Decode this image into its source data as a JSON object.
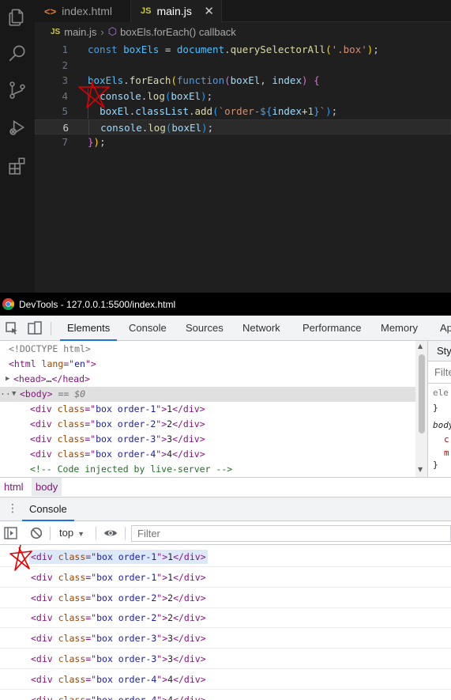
{
  "vscode": {
    "tabs": [
      {
        "label": "index.html",
        "icon": "<>"
      },
      {
        "label": "main.js",
        "icon": "JS",
        "close": "✕"
      }
    ],
    "breadcrumb": {
      "js_icon": "JS",
      "file": "main.js",
      "separator": "›",
      "symbol": "boxEls.forEach() callback"
    },
    "code_lines": [
      {
        "n": "1",
        "tokens": [
          [
            "t-kw",
            "const "
          ],
          [
            "t-var",
            "boxEls"
          ],
          [
            "t-op",
            " = "
          ],
          [
            "t-var",
            "document"
          ],
          [
            "t-pun",
            "."
          ],
          [
            "t-fn",
            "querySelectorAll"
          ],
          [
            "t-br1",
            "("
          ],
          [
            "t-str",
            "'.box'"
          ],
          [
            "t-br1",
            ")"
          ],
          [
            "t-pun",
            ";"
          ]
        ]
      },
      {
        "n": "2",
        "tokens": []
      },
      {
        "n": "3",
        "tokens": [
          [
            "t-var",
            "boxEls"
          ],
          [
            "t-pun",
            "."
          ],
          [
            "t-fn",
            "forEach"
          ],
          [
            "t-br1",
            "("
          ],
          [
            "t-kw",
            "function"
          ],
          [
            "t-br2",
            "("
          ],
          [
            "t-par",
            "boxEl"
          ],
          [
            "t-pun",
            ", "
          ],
          [
            "t-par",
            "index"
          ],
          [
            "t-br2",
            ")"
          ],
          [
            "t-pun",
            " "
          ],
          [
            "t-br2",
            "{"
          ]
        ]
      },
      {
        "n": "4",
        "tokens": [
          [
            "t-pun",
            "  "
          ],
          [
            "t-par",
            "console"
          ],
          [
            "t-pun",
            "."
          ],
          [
            "t-fn",
            "log"
          ],
          [
            "t-br3",
            "("
          ],
          [
            "t-par",
            "boxEl"
          ],
          [
            "t-br3",
            ")"
          ],
          [
            "t-pun",
            ";"
          ]
        ]
      },
      {
        "n": "5",
        "tokens": [
          [
            "t-pun",
            "  "
          ],
          [
            "t-par",
            "boxEl"
          ],
          [
            "t-pun",
            "."
          ],
          [
            "t-par",
            "classList"
          ],
          [
            "t-pun",
            "."
          ],
          [
            "t-fn",
            "add"
          ],
          [
            "t-br3",
            "("
          ],
          [
            "t-str",
            "`order-"
          ],
          [
            "t-tpl",
            "${"
          ],
          [
            "t-par",
            "index"
          ],
          [
            "t-op",
            "+"
          ],
          [
            "t-num",
            "1"
          ],
          [
            "t-tpl",
            "}"
          ],
          [
            "t-str",
            "`"
          ],
          [
            "t-br3",
            ")"
          ],
          [
            "t-pun",
            ";"
          ]
        ]
      },
      {
        "n": "6",
        "tokens": [
          [
            "t-pun",
            "  "
          ],
          [
            "t-par",
            "console"
          ],
          [
            "t-pun",
            "."
          ],
          [
            "t-fn",
            "log"
          ],
          [
            "t-br3",
            "("
          ],
          [
            "t-par",
            "boxEl"
          ],
          [
            "t-br3",
            ")"
          ],
          [
            "t-pun",
            ";"
          ]
        ]
      },
      {
        "n": "7",
        "tokens": [
          [
            "t-br2",
            "}"
          ],
          [
            "t-br1",
            ")"
          ],
          [
            "t-pun",
            ";"
          ]
        ]
      }
    ],
    "current_line": "6"
  },
  "devtools": {
    "title": "DevTools - 127.0.0.1:5500/index.html",
    "tabs": [
      "Elements",
      "Console",
      "Sources",
      "Network",
      "Performance",
      "Memory",
      "Ap"
    ],
    "active_tab": "Elements",
    "elements": [
      {
        "tri": "",
        "tokens": [
          [
            "doctype",
            "<!DOCTYPE html>"
          ]
        ]
      },
      {
        "tri": "",
        "tokens": [
          [
            "tag",
            "<html "
          ],
          [
            "attr-n",
            "lang"
          ],
          [
            "tag",
            "=\""
          ],
          [
            "attr-v",
            "en"
          ],
          [
            "tag",
            "\">"
          ]
        ]
      },
      {
        "tri": "▶",
        "tokens": [
          [
            "tag",
            "<head>"
          ],
          [
            "txt",
            "…"
          ],
          [
            "tag",
            "</head>"
          ]
        ]
      },
      {
        "tri": "▼",
        "prefix": "···",
        "tokens": [
          [
            "tag",
            "<body>"
          ],
          [
            "dim",
            " == $0"
          ]
        ]
      },
      {
        "tri": "",
        "tokens": [
          [
            "tag",
            "<div "
          ],
          [
            "attr-n",
            "class"
          ],
          [
            "tag",
            "=\""
          ],
          [
            "attr-v",
            "box order-1"
          ],
          [
            "tag",
            "\">"
          ],
          [
            "txt",
            "1"
          ],
          [
            "tag",
            "</div>"
          ]
        ]
      },
      {
        "tri": "",
        "tokens": [
          [
            "tag",
            "<div "
          ],
          [
            "attr-n",
            "class"
          ],
          [
            "tag",
            "=\""
          ],
          [
            "attr-v",
            "box order-2"
          ],
          [
            "tag",
            "\">"
          ],
          [
            "txt",
            "2"
          ],
          [
            "tag",
            "</div>"
          ]
        ]
      },
      {
        "tri": "",
        "tokens": [
          [
            "tag",
            "<div "
          ],
          [
            "attr-n",
            "class"
          ],
          [
            "tag",
            "=\""
          ],
          [
            "attr-v",
            "box order-3"
          ],
          [
            "tag",
            "\">"
          ],
          [
            "txt",
            "3"
          ],
          [
            "tag",
            "</div>"
          ]
        ]
      },
      {
        "tri": "",
        "tokens": [
          [
            "tag",
            "<div "
          ],
          [
            "attr-n",
            "class"
          ],
          [
            "tag",
            "=\""
          ],
          [
            "attr-v",
            "box order-4"
          ],
          [
            "tag",
            "\">"
          ],
          [
            "txt",
            "4"
          ],
          [
            "tag",
            "</div>"
          ]
        ]
      },
      {
        "tri": "",
        "tokens": [
          [
            "comment",
            "<!-- Code injected by live-server -->"
          ]
        ]
      }
    ],
    "styles": {
      "tab": "Sty",
      "filter": "Filte",
      "rule1": "ele",
      "brace_close": "}",
      "rule2": "body",
      "c": "c",
      "m": "m",
      "brace_close2": "}"
    },
    "crumbs": [
      "html",
      "body"
    ],
    "drawer": {
      "menu_icon": "⋮",
      "tab": "Console",
      "context": "top",
      "context_arrow": "▼",
      "filter_placeholder": "Filter",
      "logs": [
        {
          "tokens": [
            [
              "tag",
              "<div "
            ],
            [
              "attr-n",
              "class"
            ],
            [
              "tag",
              "=\""
            ],
            [
              "attr-v",
              "box order-1"
            ],
            [
              "tag",
              "\">"
            ],
            [
              "txt",
              "1"
            ],
            [
              "tag",
              "</div>"
            ]
          ],
          "highlight": true
        },
        {
          "tokens": [
            [
              "tag",
              "<div "
            ],
            [
              "attr-n",
              "class"
            ],
            [
              "tag",
              "=\""
            ],
            [
              "attr-v",
              "box order-1"
            ],
            [
              "tag",
              "\">"
            ],
            [
              "txt",
              "1"
            ],
            [
              "tag",
              "</div>"
            ]
          ],
          "highlight": false
        },
        {
          "tokens": [
            [
              "tag",
              "<div "
            ],
            [
              "attr-n",
              "class"
            ],
            [
              "tag",
              "=\""
            ],
            [
              "attr-v",
              "box order-2"
            ],
            [
              "tag",
              "\">"
            ],
            [
              "txt",
              "2"
            ],
            [
              "tag",
              "</div>"
            ]
          ],
          "highlight": false
        },
        {
          "tokens": [
            [
              "tag",
              "<div "
            ],
            [
              "attr-n",
              "class"
            ],
            [
              "tag",
              "=\""
            ],
            [
              "attr-v",
              "box order-2"
            ],
            [
              "tag",
              "\">"
            ],
            [
              "txt",
              "2"
            ],
            [
              "tag",
              "</div>"
            ]
          ],
          "highlight": false
        },
        {
          "tokens": [
            [
              "tag",
              "<div "
            ],
            [
              "attr-n",
              "class"
            ],
            [
              "tag",
              "=\""
            ],
            [
              "attr-v",
              "box order-3"
            ],
            [
              "tag",
              "\">"
            ],
            [
              "txt",
              "3"
            ],
            [
              "tag",
              "</div>"
            ]
          ],
          "highlight": false
        },
        {
          "tokens": [
            [
              "tag",
              "<div "
            ],
            [
              "attr-n",
              "class"
            ],
            [
              "tag",
              "=\""
            ],
            [
              "attr-v",
              "box order-3"
            ],
            [
              "tag",
              "\">"
            ],
            [
              "txt",
              "3"
            ],
            [
              "tag",
              "</div>"
            ]
          ],
          "highlight": false
        },
        {
          "tokens": [
            [
              "tag",
              "<div "
            ],
            [
              "attr-n",
              "class"
            ],
            [
              "tag",
              "=\""
            ],
            [
              "attr-v",
              "box order-4"
            ],
            [
              "tag",
              "\">"
            ],
            [
              "txt",
              "4"
            ],
            [
              "tag",
              "</div>"
            ]
          ],
          "highlight": false
        },
        {
          "tokens": [
            [
              "tag",
              "<div "
            ],
            [
              "attr-n",
              "class"
            ],
            [
              "tag",
              "=\""
            ],
            [
              "attr-v",
              "box order-4"
            ],
            [
              "tag",
              "\">"
            ],
            [
              "txt",
              "4"
            ],
            [
              "tag",
              "</div>"
            ]
          ],
          "highlight": false
        }
      ]
    }
  },
  "colors": {
    "annotation": "#e00000",
    "accent": "#1a73e8"
  }
}
